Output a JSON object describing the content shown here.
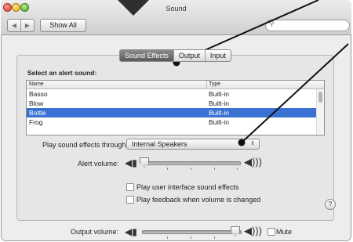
{
  "window": {
    "title": "Sound"
  },
  "toolbar": {
    "back_icon": "chevron-left-icon",
    "forward_icon": "chevron-right-icon",
    "show_all_label": "Show All",
    "search_placeholder": ""
  },
  "tabs": [
    {
      "label": "Sound Effects",
      "active": true
    },
    {
      "label": "Output",
      "active": false
    },
    {
      "label": "Input",
      "active": false
    }
  ],
  "effects": {
    "select_label": "Select an alert sound:",
    "columns": [
      "Name",
      "Type"
    ],
    "rows": [
      {
        "name": "Basso",
        "type": "Built-in"
      },
      {
        "name": "Blow",
        "type": "Built-in"
      },
      {
        "name": "Bottle",
        "type": "Built-in",
        "selected": true
      },
      {
        "name": "Frog",
        "type": "Built-in"
      }
    ],
    "play_through_label": "Play sound effects through:",
    "play_through_value": "Internal Speakers",
    "alert_volume_label": "Alert volume:",
    "alert_volume_level": 0.0,
    "ui_sound_label": "Play user interface sound effects",
    "ui_sound_checked": false,
    "feedback_label": "Play feedback when volume is changed",
    "feedback_checked": false,
    "help_label": "?"
  },
  "output": {
    "volume_label": "Output volume:",
    "volume_level": 0.92,
    "mute_label": "Mute",
    "mute_checked": false
  },
  "colors": {
    "selection": "#3a72d3",
    "annotation": "#111111"
  }
}
